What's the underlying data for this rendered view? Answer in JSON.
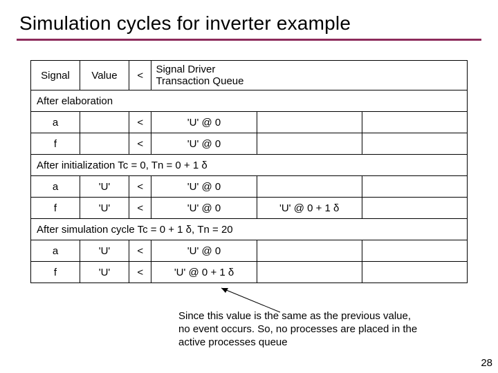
{
  "title": "Simulation cycles for inverter example",
  "headers": {
    "signal": "Signal",
    "value": "Value",
    "arrow": "<",
    "queue": "Signal Driver Transaction Queue"
  },
  "sections": [
    {
      "label": "After elaboration",
      "rows": [
        {
          "signal": "a",
          "value": "",
          "arrow": "<",
          "q1": "'U' @ 0",
          "q2": "",
          "q3": ""
        },
        {
          "signal": "f",
          "value": "",
          "arrow": "<",
          "q1": "'U' @ 0",
          "q2": "",
          "q3": ""
        }
      ]
    },
    {
      "label": "After initialization Tc = 0, Tn = 0 + 1 δ",
      "rows": [
        {
          "signal": "a",
          "value": "'U'",
          "arrow": "<",
          "q1": "'U' @ 0",
          "q2": "",
          "q3": ""
        },
        {
          "signal": "f",
          "value": "'U'",
          "arrow": "<",
          "q1": "'U' @ 0",
          "q2": "'U' @ 0 + 1 δ",
          "q3": ""
        }
      ]
    },
    {
      "label": "After simulation cycle Tc = 0 + 1 δ, Tn = 20",
      "rows": [
        {
          "signal": "a",
          "value": "'U'",
          "arrow": "<",
          "q1": "'U' @ 0",
          "q2": "",
          "q3": ""
        },
        {
          "signal": "f",
          "value": "'U'",
          "arrow": "<",
          "q1": "'U' @ 0 + 1 δ",
          "q2": "",
          "q3": ""
        }
      ]
    }
  ],
  "caption": "Since this value is the same as the previous value, no event occurs. So, no processes are placed in the active processes queue",
  "pagenum": "28"
}
